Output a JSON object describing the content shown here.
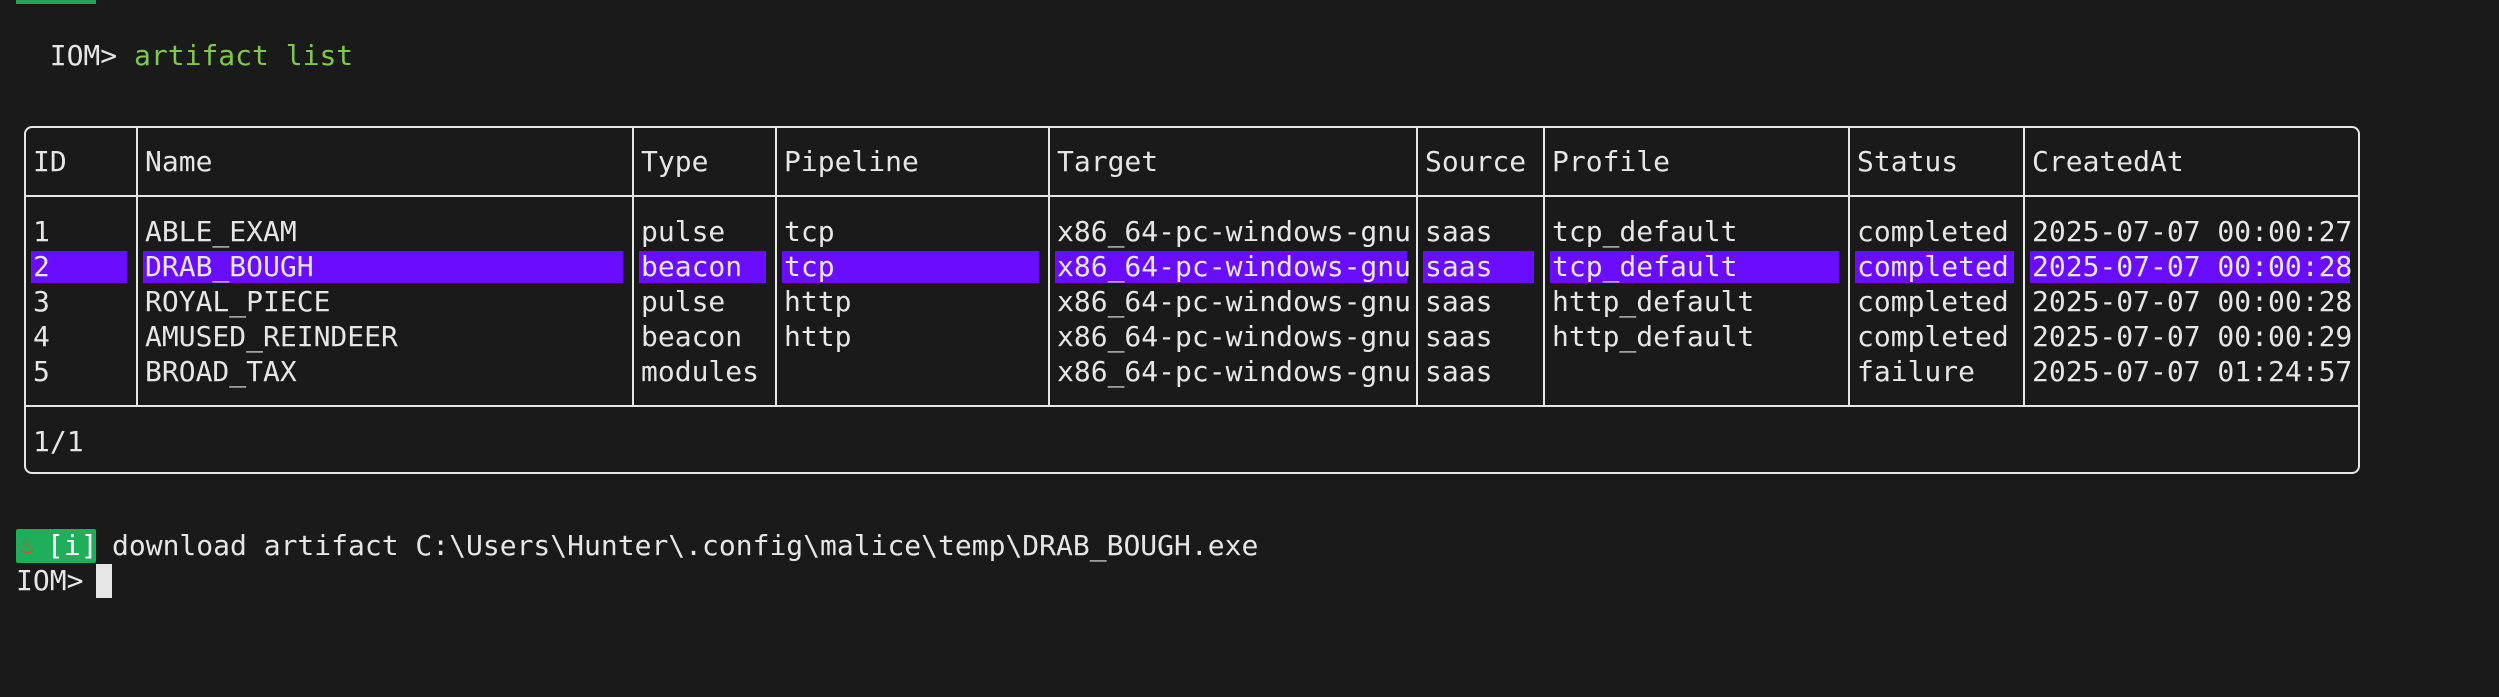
{
  "terminal": {
    "prompt_label": "IOM>",
    "command": "artifact list",
    "pagination": "1/1",
    "info_badge": "[i]",
    "info_icon": "fire-icon",
    "download_message": "download artifact C:\\Users\\Hunter\\.config\\malice\\temp\\DRAB_BOUGH.exe",
    "colors": {
      "background": "#1a1a1a",
      "command": "#7fc84f",
      "highlight": "#6a0dff",
      "badge": "#1fae5a"
    }
  },
  "table": {
    "columns": [
      "ID",
      "Name",
      "Type",
      "Pipeline",
      "Target",
      "Source",
      "Profile",
      "Status",
      "CreatedAt"
    ],
    "rows": [
      [
        "1",
        "ABLE_EXAM",
        "pulse",
        "tcp",
        "x86_64-pc-windows-gnu",
        "saas",
        "tcp_default",
        "completed",
        "2025-07-07 00:00:27"
      ],
      [
        "2",
        "DRAB_BOUGH",
        "beacon",
        "tcp",
        "x86_64-pc-windows-gnu",
        "saas",
        "tcp_default",
        "completed",
        "2025-07-07 00:00:28"
      ],
      [
        "3",
        "ROYAL_PIECE",
        "pulse",
        "http",
        "x86_64-pc-windows-gnu",
        "saas",
        "http_default",
        "completed",
        "2025-07-07 00:00:28"
      ],
      [
        "4",
        "AMUSED_REINDEER",
        "beacon",
        "http",
        "x86_64-pc-windows-gnu",
        "saas",
        "http_default",
        "completed",
        "2025-07-07 00:00:29"
      ],
      [
        "5",
        "BROAD_TAX",
        "modules",
        "",
        "x86_64-pc-windows-gnu",
        "saas",
        "",
        "failure",
        "2025-07-07 01:24:57"
      ]
    ],
    "selected_row": 1
  }
}
